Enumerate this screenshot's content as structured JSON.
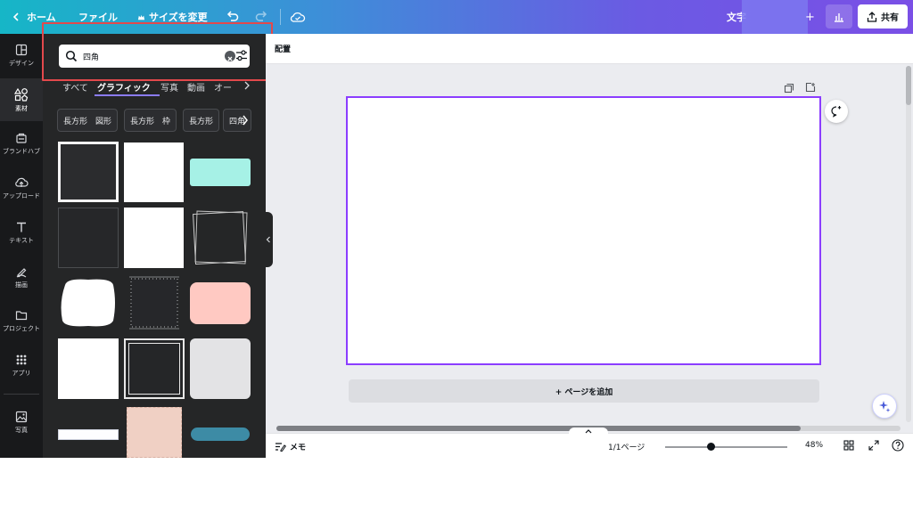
{
  "topbar": {
    "home_label": "ホーム",
    "file_label": "ファイル",
    "resize_label": "サイズを変更",
    "title_fragment": "文字",
    "share_label": "共有"
  },
  "rail": {
    "items": [
      {
        "label": "デザイン",
        "icon": "layout-icon"
      },
      {
        "label": "素材",
        "icon": "elements-icon"
      },
      {
        "label": "ブランドハブ",
        "icon": "brand-icon"
      },
      {
        "label": "アップロード",
        "icon": "upload-icon"
      },
      {
        "label": "テキスト",
        "icon": "text-icon"
      },
      {
        "label": "描画",
        "icon": "draw-icon"
      },
      {
        "label": "プロジェクト",
        "icon": "folder-icon"
      },
      {
        "label": "アプリ",
        "icon": "apps-icon"
      },
      {
        "label": "写真",
        "icon": "photo-icon"
      }
    ]
  },
  "panel": {
    "search": {
      "value": "四角"
    },
    "tabs": [
      {
        "label": "すべて"
      },
      {
        "label": "グラフィック"
      },
      {
        "label": "写真"
      },
      {
        "label": "動画"
      },
      {
        "label": "オー"
      }
    ],
    "active_tab": "グラフィック",
    "chips": [
      {
        "label": "長方形　図形"
      },
      {
        "label": "長方形　枠"
      },
      {
        "label": "長方形"
      },
      {
        "label": "四角"
      }
    ]
  },
  "editor": {
    "arrange_label": "配置",
    "add_page_label": "+ ページを追加",
    "notes_label": "メモ",
    "page_counter": "1/1ページ",
    "zoom_percent": "48%",
    "zoom_level": 0.48,
    "accent_color": "#8b3dff"
  }
}
